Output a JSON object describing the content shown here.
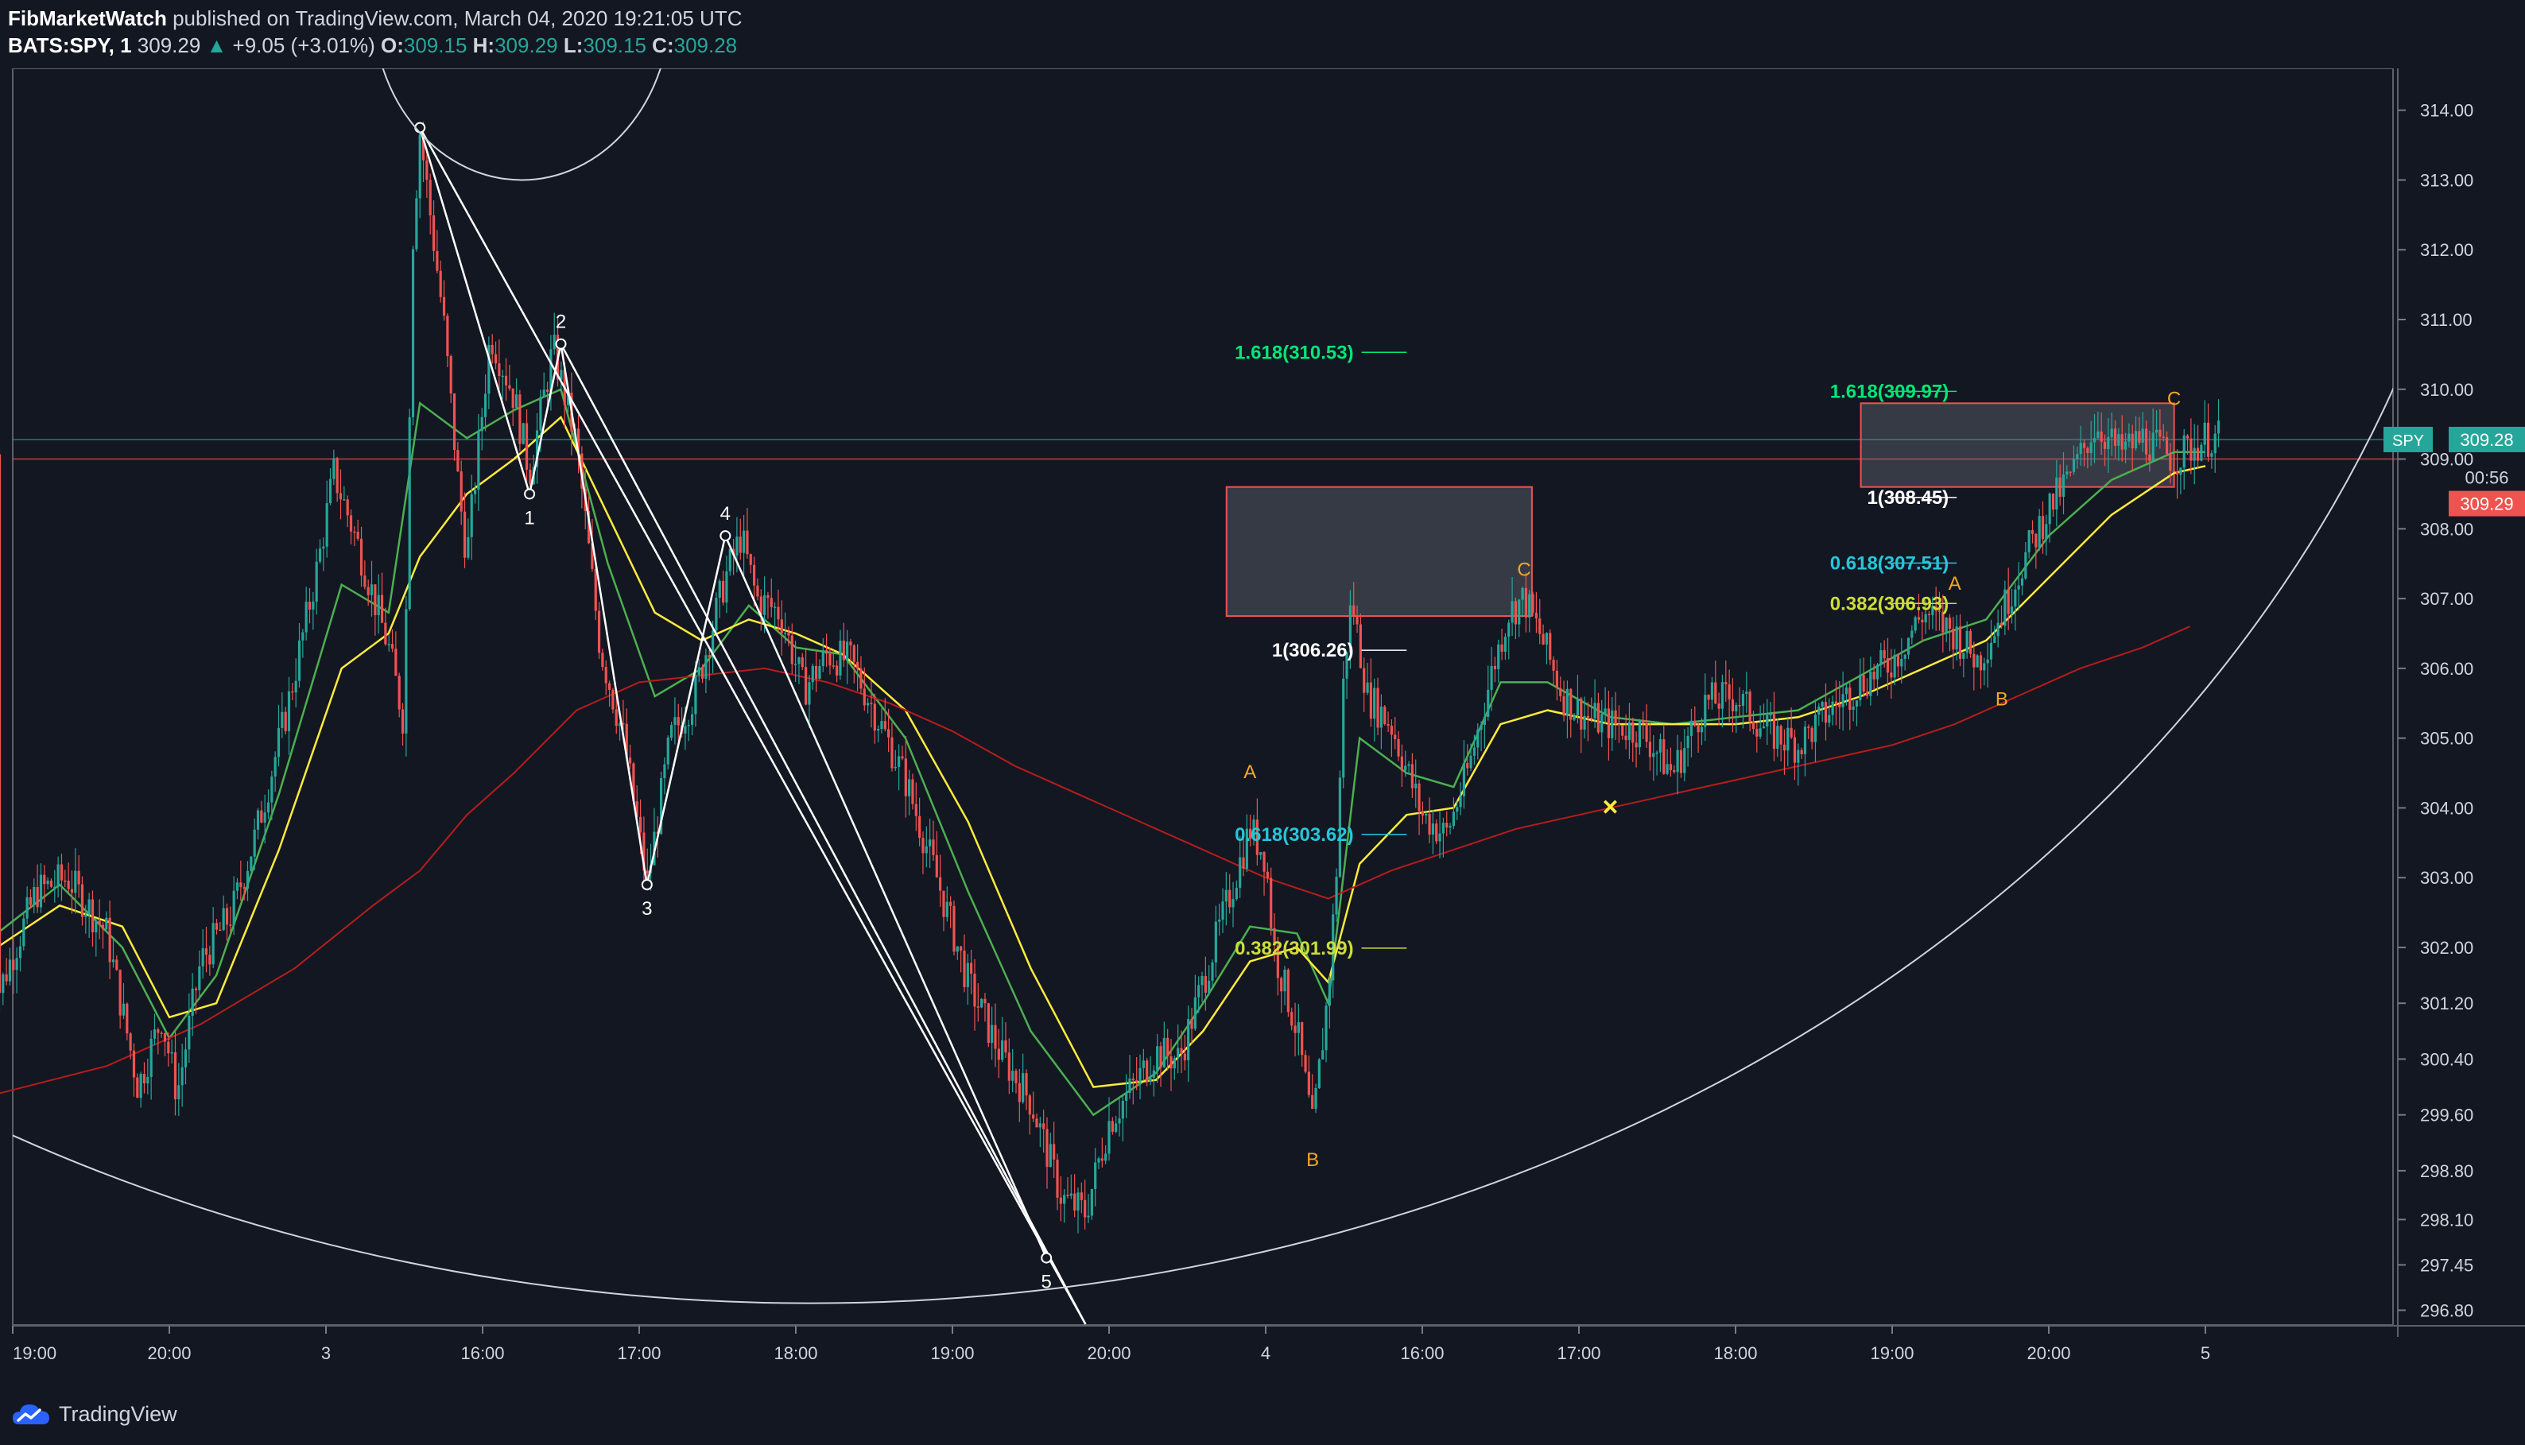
{
  "header": {
    "author": "FibMarketWatch",
    "published_text": "published on TradingView.com, March 04, 2020 19:21:05 UTC",
    "symbol": "BATS:SPY, 1",
    "last": "309.29",
    "change_arrow": "▲",
    "change": "+9.05 (+3.01%)",
    "o_label": "O:",
    "o": "309.15",
    "h_label": "H:",
    "h": "309.29",
    "l_label": "L:",
    "l": "309.15",
    "c_label": "C:",
    "c": "309.28"
  },
  "footer": {
    "brand": "TradingView"
  },
  "colors": {
    "background": "#131722",
    "up": "#26a69a",
    "down": "#ef5350",
    "ma_fast": "#4caf50",
    "ma_mid": "#ffeb3b",
    "ma_slow": "#b71c1c",
    "fib_green": "#00e676",
    "fib_teal": "#26c6da",
    "fib_yellow": "#cddc39",
    "wave_abc": "#f5a623"
  },
  "chart_data": {
    "type": "candlestick",
    "symbol": "SPY",
    "interval": "1",
    "ylim": [
      296.6,
      314.6
    ],
    "y_ticks": [
      "314.00",
      "313.00",
      "312.00",
      "311.00",
      "310.00",
      "309.00",
      "308.00",
      "307.00",
      "306.00",
      "305.00",
      "304.00",
      "303.00",
      "302.00",
      "301.20",
      "300.40",
      "299.60",
      "298.80",
      "298.10",
      "297.45",
      "296.80"
    ],
    "y_tick_values": [
      314.0,
      313.0,
      312.0,
      311.0,
      310.0,
      309.0,
      308.0,
      307.0,
      306.0,
      305.0,
      304.0,
      303.0,
      302.0,
      301.2,
      300.4,
      299.6,
      298.8,
      298.1,
      297.45,
      296.8
    ],
    "x_ticks": [
      "19:00",
      "20:00",
      "3",
      "16:00",
      "17:00",
      "18:00",
      "19:00",
      "20:00",
      "4",
      "16:00",
      "17:00",
      "18:00",
      "19:00",
      "20:00",
      "5"
    ],
    "x_tick_positions": [
      0,
      1,
      2,
      3,
      4,
      5,
      6,
      7,
      8,
      9,
      10,
      11,
      12,
      13,
      14
    ],
    "session_x_range": [
      -0.15,
      14.1
    ],
    "price_path": [
      [
        -0.1,
        301.3
      ],
      [
        0.15,
        302.8
      ],
      [
        0.35,
        303.0
      ],
      [
        0.6,
        302.2
      ],
      [
        0.8,
        300.0
      ],
      [
        0.95,
        301.0
      ],
      [
        1.05,
        299.9
      ],
      [
        1.2,
        301.8
      ],
      [
        1.4,
        302.5
      ],
      [
        1.55,
        303.6
      ],
      [
        1.75,
        305.4
      ],
      [
        1.95,
        307.5
      ],
      [
        2.05,
        308.8
      ],
      [
        2.2,
        307.8
      ],
      [
        2.4,
        306.3
      ],
      [
        2.5,
        305.2
      ],
      [
        2.55,
        312.0
      ],
      [
        2.6,
        313.7
      ],
      [
        2.75,
        311.0
      ],
      [
        2.85,
        308.5
      ],
      [
        2.9,
        307.6
      ],
      [
        3.05,
        310.8
      ],
      [
        3.2,
        309.9
      ],
      [
        3.3,
        308.8
      ],
      [
        3.45,
        310.6
      ],
      [
        3.6,
        309.2
      ],
      [
        3.75,
        306.3
      ],
      [
        3.9,
        305.0
      ],
      [
        4.05,
        302.9
      ],
      [
        4.2,
        305.0
      ],
      [
        4.35,
        305.6
      ],
      [
        4.55,
        307.3
      ],
      [
        4.65,
        307.9
      ],
      [
        4.75,
        307.0
      ],
      [
        4.9,
        306.8
      ],
      [
        5.05,
        305.7
      ],
      [
        5.2,
        306.2
      ],
      [
        5.35,
        306.1
      ],
      [
        5.5,
        305.4
      ],
      [
        5.7,
        304.4
      ],
      [
        5.9,
        303.0
      ],
      [
        6.1,
        301.5
      ],
      [
        6.3,
        300.5
      ],
      [
        6.5,
        299.8
      ],
      [
        6.7,
        298.4
      ],
      [
        6.85,
        298.2
      ],
      [
        7.0,
        299.5
      ],
      [
        7.15,
        300.0
      ],
      [
        7.3,
        300.5
      ],
      [
        7.45,
        300.4
      ],
      [
        7.6,
        301.5
      ],
      [
        7.75,
        302.6
      ],
      [
        7.9,
        303.7
      ],
      [
        8.0,
        303.3
      ],
      [
        8.05,
        302.0
      ],
      [
        8.2,
        300.8
      ],
      [
        8.3,
        299.4
      ],
      [
        8.4,
        301.4
      ],
      [
        8.45,
        303.0
      ],
      [
        8.5,
        306.0
      ],
      [
        8.55,
        307.0
      ],
      [
        8.65,
        305.6
      ],
      [
        8.8,
        305.2
      ],
      [
        9.0,
        303.9
      ],
      [
        9.15,
        303.6
      ],
      [
        9.3,
        304.6
      ],
      [
        9.45,
        306.0
      ],
      [
        9.55,
        306.8
      ],
      [
        9.65,
        307.0
      ],
      [
        9.75,
        306.5
      ],
      [
        9.9,
        305.6
      ],
      [
        10.05,
        305.3
      ],
      [
        10.2,
        305.2
      ],
      [
        10.4,
        305.1
      ],
      [
        10.6,
        304.5
      ],
      [
        10.8,
        305.5
      ],
      [
        11.0,
        305.6
      ],
      [
        11.2,
        305.1
      ],
      [
        11.4,
        304.9
      ],
      [
        11.6,
        305.4
      ],
      [
        11.8,
        305.8
      ],
      [
        12.0,
        306.1
      ],
      [
        12.2,
        306.8
      ],
      [
        12.4,
        306.5
      ],
      [
        12.55,
        306.1
      ],
      [
        12.7,
        306.8
      ],
      [
        12.85,
        307.6
      ],
      [
        13.0,
        308.3
      ],
      [
        13.15,
        308.8
      ],
      [
        13.3,
        309.5
      ],
      [
        13.45,
        309.1
      ],
      [
        13.6,
        309.3
      ],
      [
        13.8,
        309.0
      ],
      [
        14.0,
        309.3
      ]
    ],
    "price_lines": [
      {
        "name": "SPY",
        "value": 309.28,
        "label": "309.28",
        "color": "#26a69a"
      },
      {
        "name": "countdown",
        "value": 309.0,
        "label": "00:56",
        "color": "#131722"
      },
      {
        "name": "prev-close",
        "value": 309.0,
        "label": "309.29",
        "color": "#ef5350"
      }
    ],
    "moving_averages": [
      {
        "name": "ma-fast",
        "color": "#4caf50",
        "points": [
          [
            -0.1,
            302.2
          ],
          [
            0.3,
            302.9
          ],
          [
            0.7,
            302.0
          ],
          [
            1.0,
            300.7
          ],
          [
            1.3,
            301.6
          ],
          [
            1.7,
            304.2
          ],
          [
            2.1,
            307.2
          ],
          [
            2.4,
            306.8
          ],
          [
            2.6,
            309.8
          ],
          [
            2.9,
            309.3
          ],
          [
            3.2,
            309.7
          ],
          [
            3.5,
            310.0
          ],
          [
            3.8,
            307.5
          ],
          [
            4.1,
            305.6
          ],
          [
            4.4,
            306.0
          ],
          [
            4.7,
            306.9
          ],
          [
            5.0,
            306.3
          ],
          [
            5.3,
            306.2
          ],
          [
            5.7,
            305.0
          ],
          [
            6.1,
            302.8
          ],
          [
            6.5,
            300.8
          ],
          [
            6.9,
            299.6
          ],
          [
            7.3,
            300.2
          ],
          [
            7.6,
            301.2
          ],
          [
            7.9,
            302.3
          ],
          [
            8.2,
            302.2
          ],
          [
            8.4,
            301.2
          ],
          [
            8.6,
            305.0
          ],
          [
            8.9,
            304.5
          ],
          [
            9.2,
            304.3
          ],
          [
            9.5,
            305.8
          ],
          [
            9.8,
            305.8
          ],
          [
            10.2,
            305.3
          ],
          [
            10.6,
            305.2
          ],
          [
            11.0,
            305.3
          ],
          [
            11.4,
            305.4
          ],
          [
            11.8,
            305.9
          ],
          [
            12.2,
            306.4
          ],
          [
            12.6,
            306.7
          ],
          [
            13.0,
            307.9
          ],
          [
            13.4,
            308.7
          ],
          [
            13.8,
            309.1
          ],
          [
            14.0,
            309.1
          ]
        ]
      },
      {
        "name": "ma-mid",
        "color": "#ffeb3b",
        "points": [
          [
            -0.1,
            302.0
          ],
          [
            0.3,
            302.6
          ],
          [
            0.7,
            302.3
          ],
          [
            1.0,
            301.0
          ],
          [
            1.3,
            301.2
          ],
          [
            1.7,
            303.4
          ],
          [
            2.1,
            306.0
          ],
          [
            2.4,
            306.5
          ],
          [
            2.6,
            307.6
          ],
          [
            2.9,
            308.5
          ],
          [
            3.2,
            309.0
          ],
          [
            3.5,
            309.6
          ],
          [
            3.8,
            308.2
          ],
          [
            4.1,
            306.8
          ],
          [
            4.4,
            306.4
          ],
          [
            4.7,
            306.7
          ],
          [
            5.0,
            306.5
          ],
          [
            5.3,
            306.2
          ],
          [
            5.7,
            305.4
          ],
          [
            6.1,
            303.8
          ],
          [
            6.5,
            301.7
          ],
          [
            6.9,
            300.0
          ],
          [
            7.3,
            300.1
          ],
          [
            7.6,
            300.8
          ],
          [
            7.9,
            301.8
          ],
          [
            8.2,
            302.0
          ],
          [
            8.4,
            301.5
          ],
          [
            8.6,
            303.2
          ],
          [
            8.9,
            303.9
          ],
          [
            9.2,
            304.0
          ],
          [
            9.5,
            305.2
          ],
          [
            9.8,
            305.4
          ],
          [
            10.2,
            305.2
          ],
          [
            10.6,
            305.2
          ],
          [
            11.0,
            305.2
          ],
          [
            11.4,
            305.3
          ],
          [
            11.8,
            305.6
          ],
          [
            12.2,
            306.0
          ],
          [
            12.6,
            306.4
          ],
          [
            13.0,
            307.3
          ],
          [
            13.4,
            308.2
          ],
          [
            13.8,
            308.8
          ],
          [
            14.0,
            308.9
          ]
        ]
      },
      {
        "name": "ma-slow",
        "color": "#b71c1c",
        "points": [
          [
            -0.1,
            299.9
          ],
          [
            0.6,
            300.3
          ],
          [
            1.2,
            300.9
          ],
          [
            1.8,
            301.7
          ],
          [
            2.3,
            302.6
          ],
          [
            2.6,
            303.1
          ],
          [
            2.9,
            303.9
          ],
          [
            3.2,
            304.5
          ],
          [
            3.6,
            305.4
          ],
          [
            4.0,
            305.8
          ],
          [
            4.4,
            305.9
          ],
          [
            4.8,
            306.0
          ],
          [
            5.2,
            305.8
          ],
          [
            5.6,
            305.5
          ],
          [
            6.0,
            305.1
          ],
          [
            6.4,
            304.6
          ],
          [
            6.8,
            304.2
          ],
          [
            7.2,
            303.8
          ],
          [
            7.6,
            303.4
          ],
          [
            8.0,
            303.0
          ],
          [
            8.4,
            302.7
          ],
          [
            8.8,
            303.1
          ],
          [
            9.2,
            303.4
          ],
          [
            9.6,
            303.7
          ],
          [
            10.0,
            303.9
          ],
          [
            10.4,
            304.1
          ],
          [
            10.8,
            304.3
          ],
          [
            11.2,
            304.5
          ],
          [
            11.6,
            304.7
          ],
          [
            12.0,
            304.9
          ],
          [
            12.4,
            305.2
          ],
          [
            12.8,
            305.6
          ],
          [
            13.2,
            306.0
          ],
          [
            13.6,
            306.3
          ],
          [
            13.9,
            306.6
          ]
        ]
      }
    ],
    "wave_labels": [
      {
        "text": "1",
        "x": 3.3,
        "y": 308.5,
        "anchor": "below",
        "color": "#ffffff"
      },
      {
        "text": "2",
        "x": 3.5,
        "y": 310.65,
        "anchor": "above",
        "color": "#ffffff"
      },
      {
        "text": "3",
        "x": 4.05,
        "y": 302.9,
        "anchor": "below",
        "color": "#ffffff"
      },
      {
        "text": "4",
        "x": 4.55,
        "y": 307.9,
        "anchor": "above",
        "color": "#ffffff"
      },
      {
        "text": "5",
        "x": 6.6,
        "y": 297.55,
        "anchor": "below",
        "color": "#ffffff"
      },
      {
        "text": "A",
        "x": 7.9,
        "y": 304.2,
        "anchor": "above",
        "color": "#f5a623"
      },
      {
        "text": "B",
        "x": 8.3,
        "y": 299.3,
        "anchor": "below",
        "color": "#f5a623"
      },
      {
        "text": "C",
        "x": 9.65,
        "y": 307.1,
        "anchor": "above",
        "color": "#f5a623"
      },
      {
        "text": "A",
        "x": 12.4,
        "y": 306.9,
        "anchor": "above",
        "color": "#f5a623"
      },
      {
        "text": "B",
        "x": 12.7,
        "y": 305.9,
        "anchor": "below",
        "color": "#f5a623"
      },
      {
        "text": "C",
        "x": 13.8,
        "y": 309.55,
        "anchor": "above",
        "color": "#f5a623"
      },
      {
        "text": "×",
        "x": 10.2,
        "y": 304.0,
        "anchor": "center",
        "color": "#ffeb3b"
      }
    ],
    "fib_levels": [
      {
        "label": "1.618(310.53)",
        "value": 310.53,
        "x_start": 7.8,
        "x_end": 8.9,
        "color": "#00e676"
      },
      {
        "label": "1(306.26)",
        "value": 306.26,
        "x_start": 7.8,
        "x_end": 8.9,
        "color": "#ffffff"
      },
      {
        "label": "0.618(303.62)",
        "value": 303.62,
        "x_start": 7.8,
        "x_end": 8.9,
        "color": "#26c6da"
      },
      {
        "label": "0.382(301.99)",
        "value": 301.99,
        "x_start": 7.8,
        "x_end": 8.9,
        "color": "#cddc39"
      },
      {
        "label": "1.618(309.97)",
        "value": 309.97,
        "x_start": 11.6,
        "x_end": 12.0,
        "color": "#00e676"
      },
      {
        "label": "1(308.45)",
        "value": 308.45,
        "x_start": 11.6,
        "x_end": 12.0,
        "color": "#ffffff"
      },
      {
        "label": "0.618(307.51)",
        "value": 307.51,
        "x_start": 11.6,
        "x_end": 12.0,
        "color": "#26c6da"
      },
      {
        "label": "0.382(306.93)",
        "value": 306.93,
        "x_start": 11.6,
        "x_end": 12.0,
        "color": "#cddc39"
      }
    ],
    "zones": [
      {
        "x_start": 7.75,
        "x_end": 9.7,
        "y_top": 308.6,
        "y_bottom": 306.75
      },
      {
        "x_start": 11.8,
        "x_end": 13.8,
        "y_top": 309.8,
        "y_bottom": 308.6
      }
    ],
    "wave_lines": [
      {
        "points": [
          [
            2.6,
            313.75
          ],
          [
            3.3,
            308.5
          ],
          [
            3.5,
            310.65
          ],
          [
            4.05,
            302.9
          ],
          [
            4.55,
            307.9
          ],
          [
            6.6,
            297.55
          ]
        ]
      },
      {
        "points": [
          [
            2.6,
            313.75
          ],
          [
            6.85,
            296.6
          ]
        ]
      },
      {
        "points": [
          [
            3.5,
            310.65
          ],
          [
            6.85,
            296.6
          ]
        ]
      }
    ],
    "arcs": [
      {
        "name": "big-arc",
        "cx": 5.1,
        "cy": 317.2,
        "r_x": 10.8,
        "r_y": 20.3
      },
      {
        "name": "small-arc",
        "cx": 3.25,
        "cy": 315.5,
        "r_x": 0.95,
        "r_y": 2.5
      }
    ]
  }
}
